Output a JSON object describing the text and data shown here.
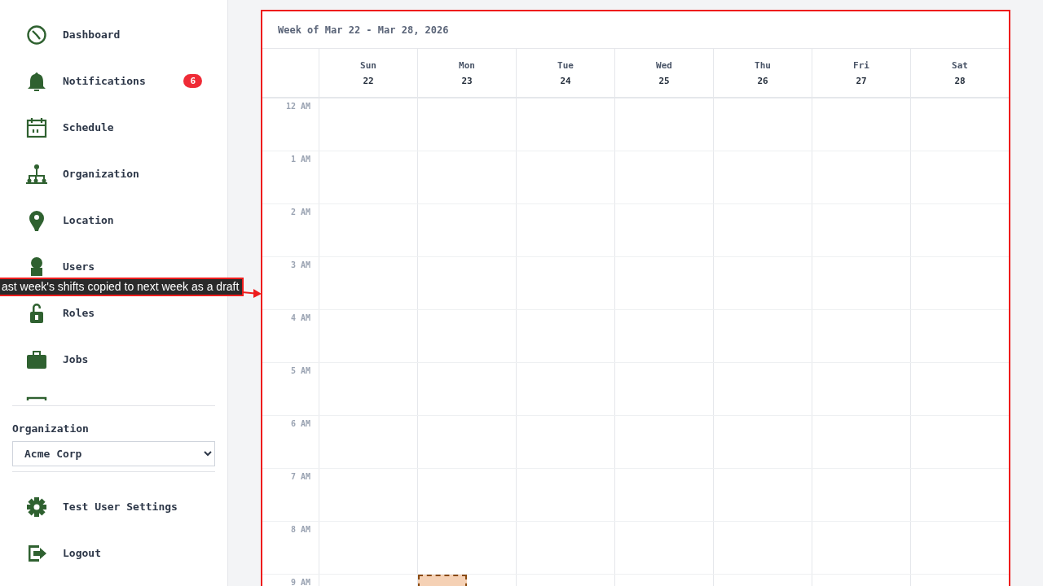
{
  "sidebar": {
    "nav_items": [
      {
        "label": "Dashboard"
      },
      {
        "label": "Notifications",
        "badge": "6"
      },
      {
        "label": "Schedule"
      },
      {
        "label": "Organization"
      },
      {
        "label": "Location"
      },
      {
        "label": "Users"
      },
      {
        "label": "Roles"
      },
      {
        "label": "Jobs"
      }
    ],
    "organization": {
      "label": "Organization",
      "value": "Acme Corp"
    },
    "footer_items": [
      {
        "label": "Test User Settings"
      },
      {
        "label": "Logout"
      }
    ]
  },
  "calendar": {
    "title": "Week of Mar 22 - Mar 28, 2026",
    "days": [
      {
        "name": "Sun",
        "date": "22"
      },
      {
        "name": "Mon",
        "date": "23"
      },
      {
        "name": "Tue",
        "date": "24"
      },
      {
        "name": "Wed",
        "date": "25"
      },
      {
        "name": "Thu",
        "date": "26"
      },
      {
        "name": "Fri",
        "date": "27"
      },
      {
        "name": "Sat",
        "date": "28"
      }
    ],
    "rows": [
      {
        "time": "12 AM",
        "cells": [
          {
            "draft_shift": false
          },
          {
            "draft_shift": false
          },
          {
            "draft_shift": false
          },
          {
            "draft_shift": false
          },
          {
            "draft_shift": false
          },
          {
            "draft_shift": false
          },
          {
            "draft_shift": false
          }
        ]
      },
      {
        "time": "1 AM",
        "cells": [
          {
            "draft_shift": false
          },
          {
            "draft_shift": false
          },
          {
            "draft_shift": false
          },
          {
            "draft_shift": false
          },
          {
            "draft_shift": false
          },
          {
            "draft_shift": false
          },
          {
            "draft_shift": false
          }
        ]
      },
      {
        "time": "2 AM",
        "cells": [
          {
            "draft_shift": false
          },
          {
            "draft_shift": false
          },
          {
            "draft_shift": false
          },
          {
            "draft_shift": false
          },
          {
            "draft_shift": false
          },
          {
            "draft_shift": false
          },
          {
            "draft_shift": false
          }
        ]
      },
      {
        "time": "3 AM",
        "cells": [
          {
            "draft_shift": false
          },
          {
            "draft_shift": false
          },
          {
            "draft_shift": false
          },
          {
            "draft_shift": false
          },
          {
            "draft_shift": false
          },
          {
            "draft_shift": false
          },
          {
            "draft_shift": false
          }
        ]
      },
      {
        "time": "4 AM",
        "cells": [
          {
            "draft_shift": false
          },
          {
            "draft_shift": false
          },
          {
            "draft_shift": false
          },
          {
            "draft_shift": false
          },
          {
            "draft_shift": false
          },
          {
            "draft_shift": false
          },
          {
            "draft_shift": false
          }
        ]
      },
      {
        "time": "5 AM",
        "cells": [
          {
            "draft_shift": false
          },
          {
            "draft_shift": false
          },
          {
            "draft_shift": false
          },
          {
            "draft_shift": false
          },
          {
            "draft_shift": false
          },
          {
            "draft_shift": false
          },
          {
            "draft_shift": false
          }
        ]
      },
      {
        "time": "6 AM",
        "cells": [
          {
            "draft_shift": false
          },
          {
            "draft_shift": false
          },
          {
            "draft_shift": false
          },
          {
            "draft_shift": false
          },
          {
            "draft_shift": false
          },
          {
            "draft_shift": false
          },
          {
            "draft_shift": false
          }
        ]
      },
      {
        "time": "7 AM",
        "cells": [
          {
            "draft_shift": false
          },
          {
            "draft_shift": false
          },
          {
            "draft_shift": false
          },
          {
            "draft_shift": false
          },
          {
            "draft_shift": false
          },
          {
            "draft_shift": false
          },
          {
            "draft_shift": false
          }
        ]
      },
      {
        "time": "8 AM",
        "cells": [
          {
            "draft_shift": false
          },
          {
            "draft_shift": false
          },
          {
            "draft_shift": false
          },
          {
            "draft_shift": false
          },
          {
            "draft_shift": false
          },
          {
            "draft_shift": false
          },
          {
            "draft_shift": false
          }
        ]
      },
      {
        "time": "9 AM",
        "cells": [
          {
            "draft_shift": false
          },
          {
            "draft_shift": true
          },
          {
            "draft_shift": false
          },
          {
            "draft_shift": false
          },
          {
            "draft_shift": false
          },
          {
            "draft_shift": false
          },
          {
            "draft_shift": false
          }
        ]
      }
    ]
  },
  "annotation": {
    "text": "ast week's shifts copied to next week as a draft"
  }
}
